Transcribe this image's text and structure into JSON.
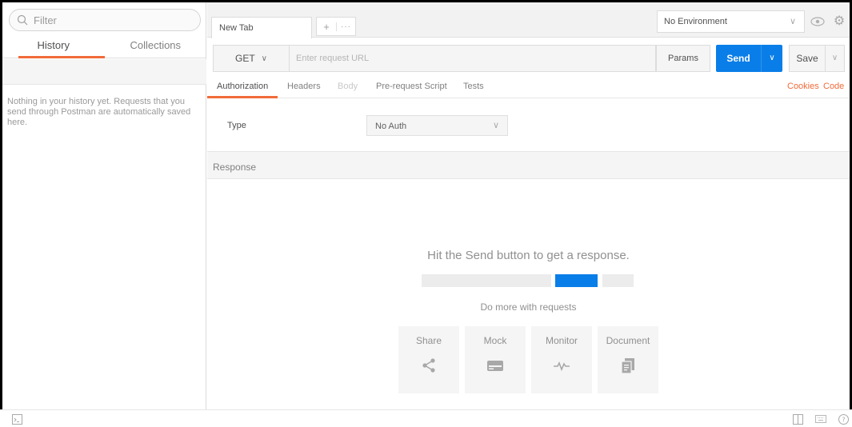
{
  "sidebar": {
    "filter_placeholder": "Filter",
    "tabs": [
      {
        "label": "History"
      },
      {
        "label": "Collections"
      }
    ],
    "empty_message": "Nothing in your history yet. Requests that you send through Postman are automatically saved here."
  },
  "tabs": {
    "active_label": "New Tab",
    "add_label": "+",
    "more_label": "···"
  },
  "environment": {
    "selected": "No Environment"
  },
  "request": {
    "method": "GET",
    "url_placeholder": "Enter request URL",
    "params_label": "Params",
    "send_label": "Send",
    "save_label": "Save"
  },
  "subtabs": {
    "authorization": "Authorization",
    "headers": "Headers",
    "body": "Body",
    "prerequest": "Pre-request Script",
    "tests": "Tests",
    "cookies": "Cookies",
    "code": "Code"
  },
  "auth": {
    "type_label": "Type",
    "selected": "No Auth"
  },
  "response": {
    "header": "Response",
    "hint": "Hit the Send button to get a response.",
    "more": "Do more with requests",
    "cards": [
      {
        "label": "Share",
        "icon": "share-icon"
      },
      {
        "label": "Mock",
        "icon": "mock-icon"
      },
      {
        "label": "Monitor",
        "icon": "monitor-icon"
      },
      {
        "label": "Document",
        "icon": "document-icon"
      }
    ]
  },
  "colors": {
    "accent": "#f26b3a",
    "primary": "#0a7ee8"
  }
}
